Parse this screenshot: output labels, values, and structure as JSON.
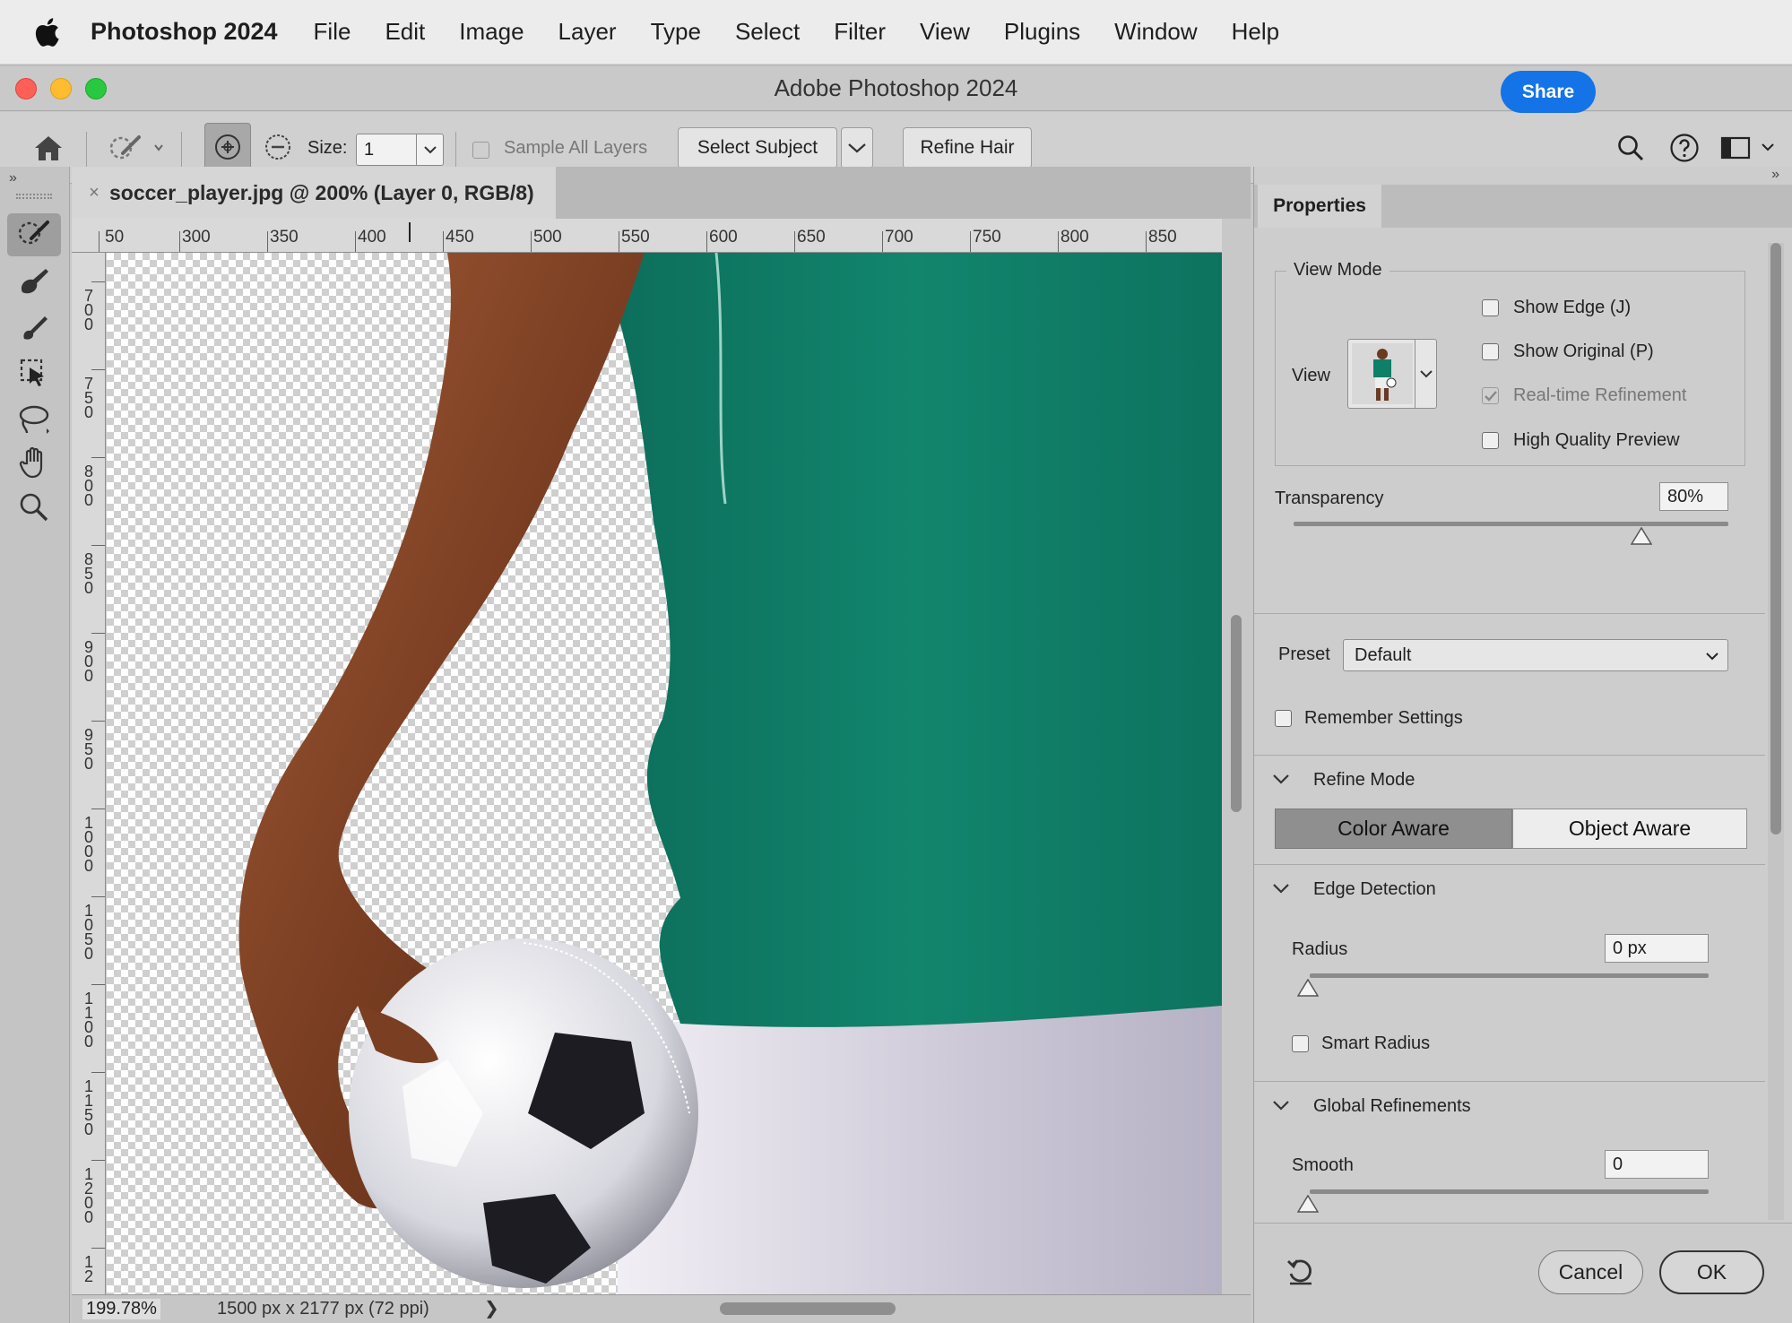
{
  "menubar": {
    "app_name": "Photoshop 2024",
    "items": [
      "File",
      "Edit",
      "Image",
      "Layer",
      "Type",
      "Select",
      "Filter",
      "View",
      "Plugins",
      "Window",
      "Help"
    ]
  },
  "window": {
    "title": "Adobe Photoshop 2024"
  },
  "options_bar": {
    "size_label": "Size:",
    "size_value": "1",
    "sample_all_layers": "Sample All Layers",
    "select_subject": "Select Subject",
    "refine_hair": "Refine Hair",
    "share": "Share"
  },
  "document": {
    "tab_title": "soccer_player.jpg @ 200% (Layer 0, RGB/8)",
    "h_ruler": [
      "50",
      "300",
      "350",
      "400",
      "450",
      "500",
      "550",
      "600",
      "650",
      "700",
      "750",
      "800",
      "850"
    ],
    "v_ruler": [
      "700",
      "750",
      "800",
      "850",
      "900",
      "950",
      "1000",
      "1050",
      "1100",
      "1150",
      "1200",
      "12"
    ]
  },
  "status": {
    "zoom": "199.78%",
    "dimensions": "1500 px x 2177 px (72 ppi)",
    "arrow": "❯"
  },
  "properties": {
    "tab": "Properties",
    "view_mode": {
      "title": "View Mode",
      "view_label": "View",
      "show_edge": "Show Edge (J)",
      "show_original": "Show Original (P)",
      "realtime_refinement": "Real-time Refinement",
      "high_quality_preview": "High Quality Preview"
    },
    "transparency": {
      "label": "Transparency",
      "value": "80%",
      "level": 80
    },
    "preset": {
      "label": "Preset",
      "value": "Default"
    },
    "remember_settings": "Remember Settings",
    "refine_mode": {
      "title": "Refine Mode",
      "color_aware": "Color Aware",
      "object_aware": "Object Aware",
      "selected": "Color Aware"
    },
    "edge_detection": {
      "title": "Edge Detection",
      "radius_label": "Radius",
      "radius_value": "0 px",
      "smart_radius": "Smart Radius"
    },
    "global_refinements": {
      "title": "Global Refinements",
      "smooth_label": "Smooth",
      "smooth_value": "0"
    },
    "cancel": "Cancel",
    "ok": "OK"
  },
  "colors": {
    "accent": "#1473e6",
    "jersey": "#0f7f68",
    "skin": "#8a4a2c",
    "shorts": "#d8d6e0"
  }
}
